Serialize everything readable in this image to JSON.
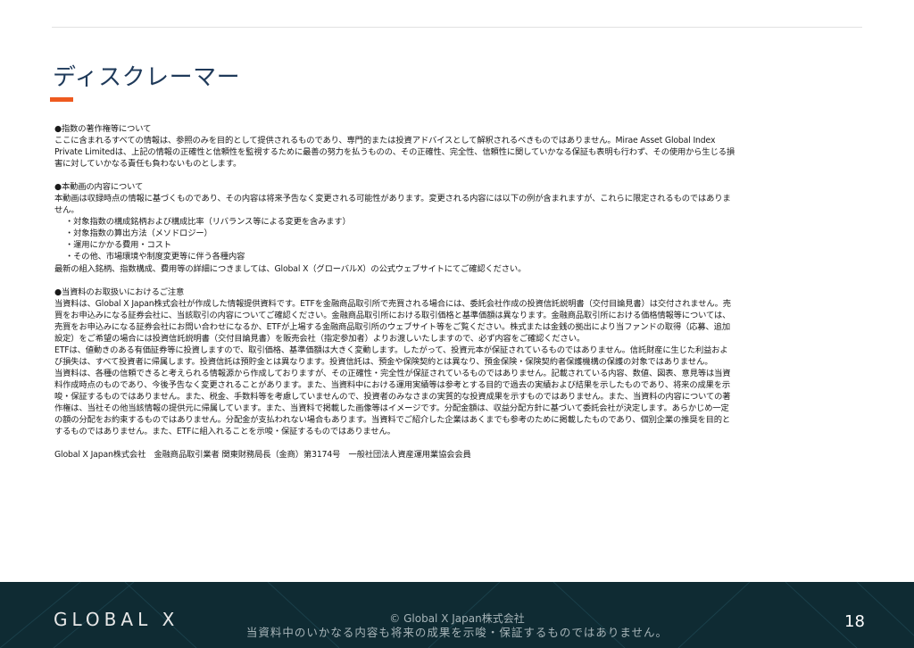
{
  "header": {
    "title": "ディスクレーマー"
  },
  "sections": [
    {
      "heading": "●指数の著作権等について",
      "lines": [
        "ここに含まれるすべての情報は、参照のみを目的として提供されるものであり、専門的または投資アドバイスとして解釈されるべきものではありません。Mirae Asset Global Index",
        "Private Limitedは、上記の情報の正確性と信頼性を監視するために最善の努力を払うものの、その正確性、完全性、信頼性に関していかなる保証も表明も行わず、その使用から生じる損",
        "害に対していかなる責任も負わないものとします。"
      ]
    },
    {
      "heading": "●本動画の内容について",
      "lines": [
        "本動画は収録時点の情報に基づくものであり、その内容は将来予告なく変更される可能性があります。変更される内容には以下の例が含まれますが、これらに限定されるものではありま",
        "せん。"
      ],
      "bullets": [
        "・対象指数の構成銘柄および構成比率（リバランス等による変更を含みます）",
        "・対象指数の算出方法（メソドロジー）",
        "・運用にかかる費用・コスト",
        "・その他、市場環境や制度変更等に伴う各種内容"
      ],
      "after": "最新の組入銘柄、指数構成、費用等の詳細につきましては、Global X（グローバルX）の公式ウェブサイトにてご確認ください。"
    },
    {
      "heading": "●当資料のお取扱いにおけるご注意",
      "lines": [
        "当資料は、Global X Japan株式会社が作成した情報提供資料です。ETFを金融商品取引所で売買される場合には、委託会社作成の投資信託説明書（交付目論見書）は交付されません。売",
        "買をお申込みになる証券会社に、当該取引の内容についてご確認ください。金融商品取引所における取引価格と基準価額は異なります。金融商品取引所における価格情報等については、",
        "売買をお申込みになる証券会社にお問い合わせになるか、ETFが上場する金融商品取引所のウェブサイト等をご覧ください。株式または金銭の拠出により当ファンドの取得（応募、追加",
        "設定）をご希望の場合には投資信託説明書（交付目論見書）を販売会社（指定参加者）よりお渡しいたしますので、必ず内容をご確認ください。",
        "ETFは、値動きのある有価証券等に投資しますので、取引価格、基準価額は大きく変動します。したがって、投資元本が保証されているものではありません。信託財産に生じた利益およ",
        "び損失は、すべて投資者に帰属します。投資信託は預貯金とは異なります。投資信託は、預金や保険契約とは異なり、預金保険・保険契約者保護機構の保護の対象ではありません。",
        "当資料は、各種の信頼できると考えられる情報源から作成しておりますが、その正確性・完全性が保証されているものではありません。記載されている内容、数値、図表、意見等は当資",
        "料作成時点のものであり、今後予告なく変更されることがあります。また、当資料中における運用実績等は参考とする目的で過去の実績および結果を示したものであり、将来の成果を示",
        "唆・保証するものではありません。また、税金、手数料等を考慮していませんので、投資者のみなさまの実質的な投資成果を示すものではありません。また、当資料の内容についての著",
        "作権は、当社その他当該情報の提供元に帰属しています。また、当資料で掲載した画像等はイメージです。分配金額は、収益分配方針に基づいて委託会社が決定します。あらかじめ一定",
        "の額の分配をお約束するものではありません。分配金が支払われない場合もあります。当資料でご紹介した企業はあくまでも参考のために掲載したものであり、個別企業の推奨を目的と",
        "するものではありません。また、ETFに組入れることを示唆・保証するものではありません。"
      ]
    }
  ],
  "registration": "Global X Japan株式会社　金融商品取引業者 関東財務局長（金商）第3174号　一般社団法人資産運用業協会会員",
  "footer": {
    "logo": "GLOBAL X",
    "copyright": "© Global X Japan株式会社",
    "disclaimer": "当資料中のいかなる内容も将来の成果を示唆・保証するものではありません。",
    "page_number": "18"
  },
  "colors": {
    "title": "#1f3a5a",
    "accent": "#ee5a1f",
    "footer_bg": "#0f2b33"
  }
}
